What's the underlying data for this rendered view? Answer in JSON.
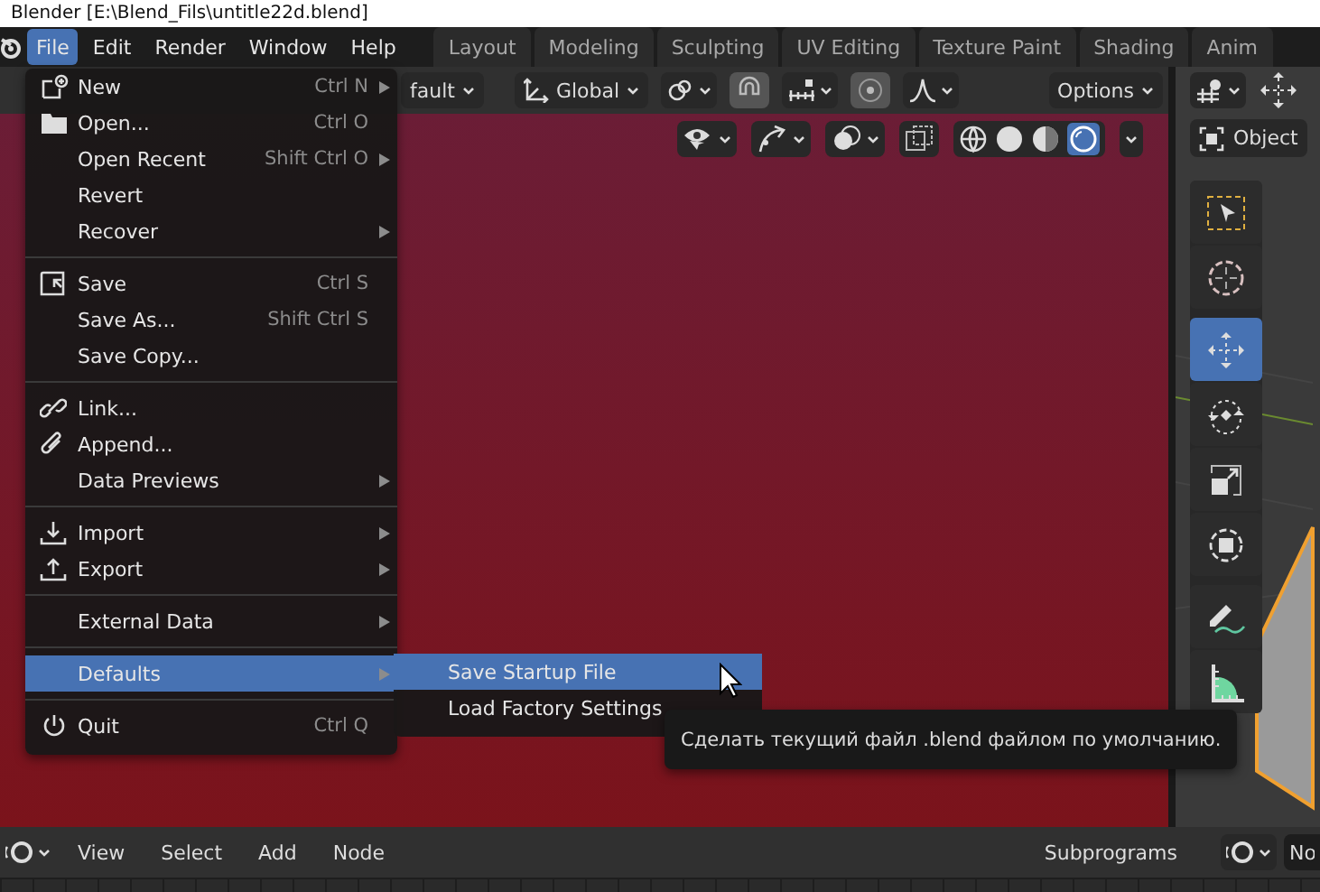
{
  "window": {
    "title": "Blender  [E:\\Blend_Fils\\untitle22d.blend]"
  },
  "menubar": [
    {
      "label": "File",
      "selected": true
    },
    {
      "label": "Edit",
      "selected": false
    },
    {
      "label": "Render",
      "selected": false
    },
    {
      "label": "Window",
      "selected": false
    },
    {
      "label": "Help",
      "selected": false
    }
  ],
  "workspace_tabs": [
    {
      "label": "Layout",
      "selected": false
    },
    {
      "label": "Modeling",
      "selected": false
    },
    {
      "label": "Sculpting",
      "selected": false
    },
    {
      "label": "UV Editing",
      "selected": false
    },
    {
      "label": "Texture Paint",
      "selected": false
    },
    {
      "label": "Shading",
      "selected": false
    },
    {
      "label": "Anim",
      "selected": false
    }
  ],
  "viewport_header": {
    "pivot": "fault",
    "orientation": "Global",
    "options": "Options"
  },
  "side_viewport": {
    "mode": "Object"
  },
  "tools": [
    {
      "kind": "select",
      "selected": false
    },
    {
      "kind": "cursor",
      "selected": false
    },
    {
      "kind": "move",
      "selected": true
    },
    {
      "kind": "rotate",
      "selected": false
    },
    {
      "kind": "scale",
      "selected": false
    },
    {
      "kind": "transform",
      "selected": false
    },
    {
      "kind": "annotate",
      "selected": false
    },
    {
      "kind": "measure",
      "selected": false
    }
  ],
  "file_menu": {
    "sections": [
      [
        {
          "label": "New",
          "shortcut": "Ctrl N",
          "kind": "new",
          "submenu": true,
          "selected": false
        },
        {
          "label": "Open...",
          "shortcut": "Ctrl O",
          "kind": "folder",
          "submenu": false,
          "selected": false
        },
        {
          "label": "Open Recent",
          "shortcut": "Shift Ctrl O",
          "submenu": true,
          "selected": false
        },
        {
          "label": "Revert",
          "submenu": false,
          "selected": false
        },
        {
          "label": "Recover",
          "submenu": true,
          "selected": false
        }
      ],
      [
        {
          "label": "Save",
          "shortcut": "Ctrl S",
          "kind": "save",
          "submenu": false,
          "selected": false
        },
        {
          "label": "Save As...",
          "shortcut": "Shift Ctrl S",
          "submenu": false,
          "selected": false
        },
        {
          "label": "Save Copy...",
          "submenu": false,
          "selected": false
        }
      ],
      [
        {
          "label": "Link...",
          "kind": "link",
          "submenu": false,
          "selected": false
        },
        {
          "label": "Append...",
          "kind": "paperclip",
          "submenu": false,
          "selected": false
        },
        {
          "label": "Data Previews",
          "submenu": true,
          "selected": false
        }
      ],
      [
        {
          "label": "Import",
          "kind": "import",
          "submenu": true,
          "selected": false
        },
        {
          "label": "Export",
          "kind": "export",
          "submenu": true,
          "selected": false
        }
      ],
      [
        {
          "label": "External Data",
          "submenu": true,
          "selected": false
        }
      ],
      [
        {
          "label": "Defaults",
          "submenu": true,
          "selected": true
        }
      ],
      [
        {
          "label": "Quit",
          "shortcut": "Ctrl Q",
          "kind": "power",
          "submenu": false,
          "selected": false
        }
      ]
    ]
  },
  "submenu": [
    {
      "label": "Save Startup File",
      "selected": true
    },
    {
      "label": "Load Factory Settings",
      "selected": false
    }
  ],
  "tooltip": "Сделать текущий файл .blend файлом по умолчанию.",
  "bottom_bar": {
    "menus": [
      "View",
      "Select",
      "Add",
      "Node"
    ],
    "label": "Subprograms",
    "field": "No"
  }
}
